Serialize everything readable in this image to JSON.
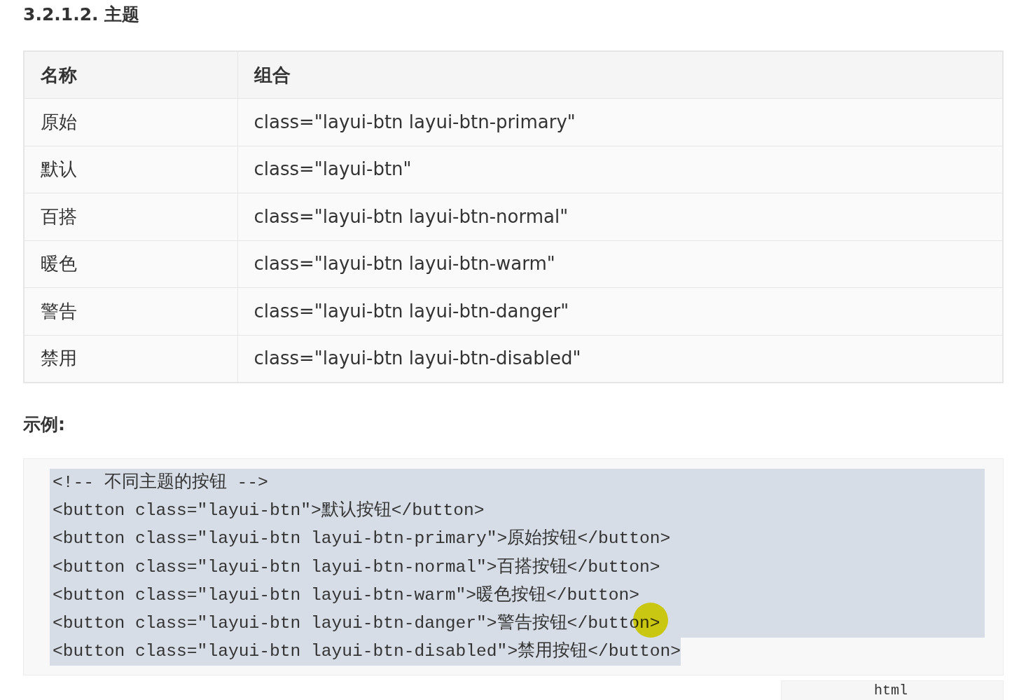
{
  "heading": "3.2.1.2. 主题",
  "table": {
    "columns": [
      "名称",
      "组合"
    ],
    "rows": [
      {
        "name": "原始",
        "value": "class=\"layui-btn layui-btn-primary\""
      },
      {
        "name": "默认",
        "value": "class=\"layui-btn\""
      },
      {
        "name": "百搭",
        "value": "class=\"layui-btn layui-btn-normal\""
      },
      {
        "name": "暖色",
        "value": "class=\"layui-btn layui-btn-warm\""
      },
      {
        "name": "警告",
        "value": "class=\"layui-btn layui-btn-danger\""
      },
      {
        "name": "禁用",
        "value": "class=\"layui-btn layui-btn-disabled\""
      }
    ]
  },
  "example_label": "示例:",
  "code": {
    "lines": [
      {
        "text": "<!-- 不同主题的按钮 -->",
        "selected": true
      },
      {
        "text": "<button class=\"layui-btn\">默认按钮</button>",
        "selected": true
      },
      {
        "text": "<button class=\"layui-btn layui-btn-primary\">原始按钮</button>",
        "selected": true
      },
      {
        "text": "<button class=\"layui-btn layui-btn-normal\">百搭按钮</button>",
        "selected": true
      },
      {
        "text": "<button class=\"layui-btn layui-btn-warm\">暖色按钮</button>",
        "selected": true
      },
      {
        "text": "<button class=\"layui-btn layui-btn-danger\">警告按钮</button>",
        "selected": true
      },
      {
        "text": "<button class=\"layui-btn layui-btn-disabled\">禁用按钮</button>",
        "selected": true
      }
    ]
  },
  "language_tag": "html"
}
